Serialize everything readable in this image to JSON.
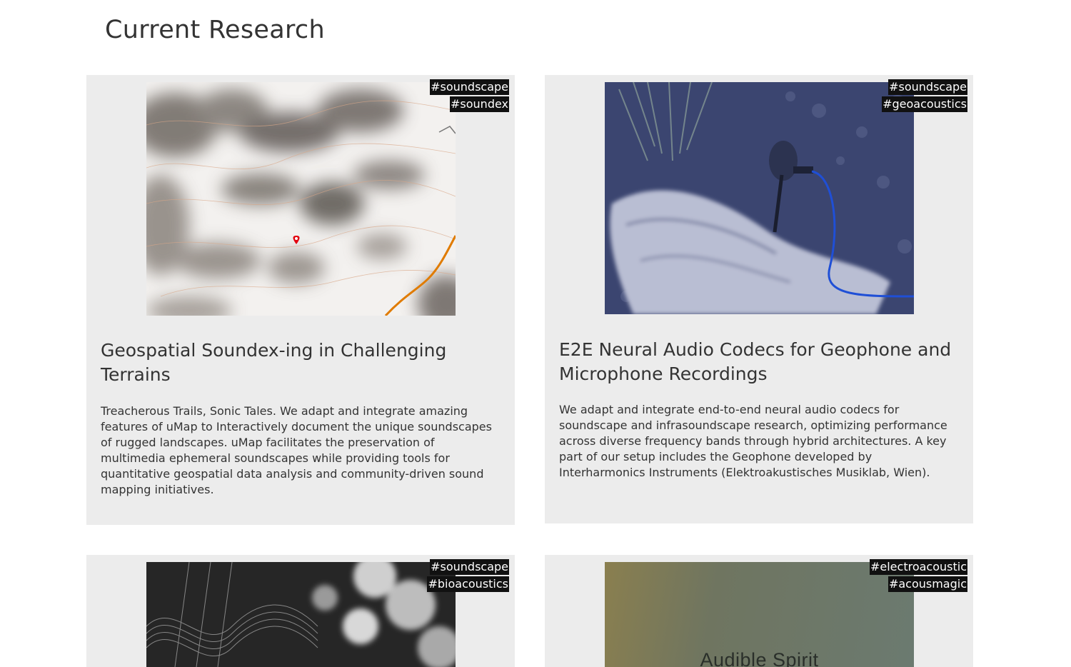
{
  "page": {
    "title": "Current Research"
  },
  "cards": [
    {
      "tags": [
        "#soundscape",
        "#soundex"
      ],
      "title": "Geospatial Soundex-ing in Challenging Terrains",
      "description": "Treacherous Trails, Sonic Tales. We adapt and integrate amazing features of uMap to Interactively document the unique soundscapes of rugged landscapes. uMap facilitates the preservation of multimedia ephemeral soundscapes while providing tools for quantitative geospatial data analysis and community-driven sound mapping initiatives."
    },
    {
      "tags": [
        "#soundscape",
        "#geoacoustics"
      ],
      "title": "E2E Neural Audio Codecs for Geophone and Microphone Recordings",
      "description": "We adapt and integrate end-to-end neural audio codecs for soundscape and infrasoundscape research, optimizing performance across diverse frequency bands through hybrid architectures. A key part of our setup includes the Geophone developed by Interharmonics Instruments (Elektroakustisches Musiklab, Wien)."
    },
    {
      "tags": [
        "#soundscape",
        "#bioacoustics"
      ]
    },
    {
      "tags": [
        "#electroacoustic",
        "#acousmagic"
      ],
      "image_text": "Audible Spirit"
    }
  ],
  "colors": {
    "card_background": "#ececec",
    "tag_background": "#111111",
    "tag_text": "#ffffff",
    "text": "#333333",
    "map_marker": "#e3000f",
    "map_road": "#e07b00",
    "cable": "#1f4fd6"
  }
}
